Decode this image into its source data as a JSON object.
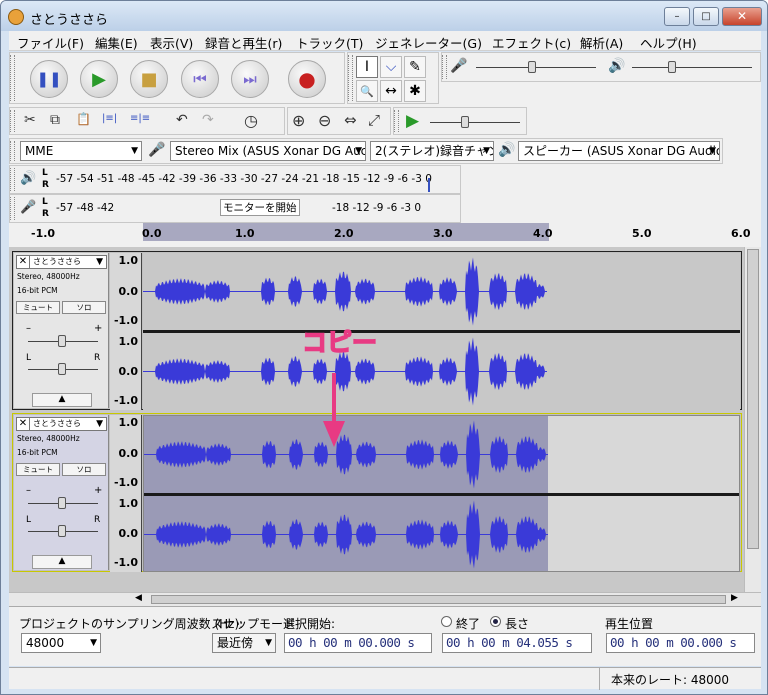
{
  "window": {
    "title": "さとうささら",
    "min": "–",
    "max": "□",
    "close": "✕"
  },
  "menu": [
    "ファイル(F)",
    "編集(E)",
    "表示(V)",
    "録音と再生(r)",
    "トラック(T)",
    "ジェネレーター(G)",
    "エフェクト(c)",
    "解析(A)",
    "ヘルプ(H)"
  ],
  "transport": {
    "pause": "❚❚",
    "play": "▶",
    "stop": "■",
    "skip_start": "⏮",
    "skip_end": "⏭",
    "record": "●"
  },
  "tools": {
    "select": "I",
    "envelope": "⌵",
    "draw": "✎",
    "zoom": "🔍",
    "timeshift": "↔",
    "multi": "✱"
  },
  "edit_tools": {
    "cut": "✂",
    "copy": "⧉",
    "paste": "📋",
    "trim": "|≡|",
    "silence": "≡|≡",
    "undo": "↶",
    "redo": "↷",
    "sync": "◷",
    "zoom_in": "⊕",
    "zoom_out": "⊖",
    "fit_sel": "⇔",
    "fit_proj": "⤢",
    "play_at_speed": "▶"
  },
  "device": {
    "host": "MME",
    "input": "Stereo Mix (ASUS Xonar DG Auc",
    "channels": "2(ステレオ)録音チャン",
    "output": "スピーカー (ASUS Xonar DG Audio"
  },
  "meters": {
    "play_scale": "-57 -54 -51 -48 -45 -42 -39 -36 -33 -30 -27 -24 -21 -18 -15 -12 -9  -6  -3  0",
    "rec_scale": "-57    -48    -42",
    "rec_scale2": "-18    -12   -9   -6   -3   0",
    "monitor": "モニターを開始",
    "L": "L",
    "R": "R"
  },
  "ruler": [
    "-1.0",
    "0.0",
    "1.0",
    "2.0",
    "3.0",
    "4.0",
    "5.0",
    "6.0"
  ],
  "tracks": [
    {
      "name": "さとうささら",
      "format": "Stereo, 48000Hz",
      "bits": "16-bit PCM",
      "mute": "ミュート",
      "solo": "ソロ",
      "minus": "–",
      "plus": "+",
      "L": "L",
      "R": "R"
    },
    {
      "name": "さとうささら",
      "format": "Stereo, 48000Hz",
      "bits": "16-bit PCM",
      "mute": "ミュート",
      "solo": "ソロ",
      "minus": "–",
      "plus": "+",
      "L": "L",
      "R": "R"
    }
  ],
  "vscale": {
    "top": "1.0",
    "mid": "0.0",
    "bot": "-1.0"
  },
  "annotation": "コピー",
  "bottom": {
    "rate_label": "プロジェクトのサンプリング周波数 (Hz):",
    "rate": "48000",
    "snap_label": "スナップモード",
    "snap": "最近傍",
    "sel_start_label": "選択開始:",
    "sel_start": "00 h 00 m 00.000 s",
    "end_label": "終了",
    "length_label": "長さ",
    "length": "00 h 00 m 04.055 s",
    "pos_label": "再生位置",
    "pos": "00 h 00 m 00.000 s"
  },
  "status": "本来のレート: 48000"
}
